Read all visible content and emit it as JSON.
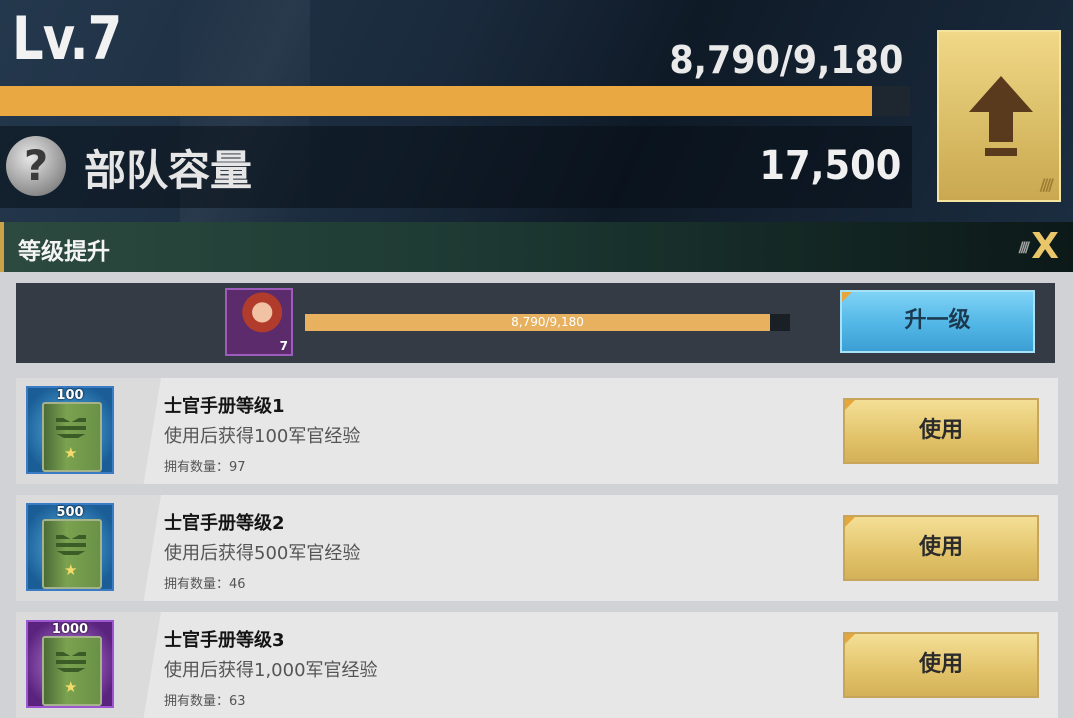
{
  "header": {
    "level": "Lv.7",
    "xp_text": "8,790/9,180",
    "xp_progress": 0.9575,
    "capacity_label": "部队容量",
    "capacity_value": "17,500",
    "help_icon_text": "?",
    "upgrade_icon": "up-arrow-icon"
  },
  "dialog": {
    "title": "等级提升",
    "close_label": "X",
    "stripes": "////"
  },
  "officer": {
    "level": "7",
    "xp_text": "8,790/9,180",
    "xp_progress": 0.9575,
    "level_up_label": "升一级"
  },
  "items": [
    {
      "amount": "100",
      "name": "士官手册等级1",
      "desc": "使用后获得100军官经验",
      "count_label": "拥有数量：97",
      "use_label": "使用",
      "rarity": "blue"
    },
    {
      "amount": "500",
      "name": "士官手册等级2",
      "desc": "使用后获得500军官经验",
      "count_label": "拥有数量：46",
      "use_label": "使用",
      "rarity": "blue"
    },
    {
      "amount": "1000",
      "name": "士官手册等级3",
      "desc": "使用后获得1,000军官经验",
      "count_label": "拥有数量：63",
      "use_label": "使用",
      "rarity": "purple"
    }
  ],
  "colors": {
    "xp_bar": "#e9a842",
    "gold_button": "#e2c36a",
    "blue_button": "#52b6e6",
    "accent": "#c9a24a"
  }
}
